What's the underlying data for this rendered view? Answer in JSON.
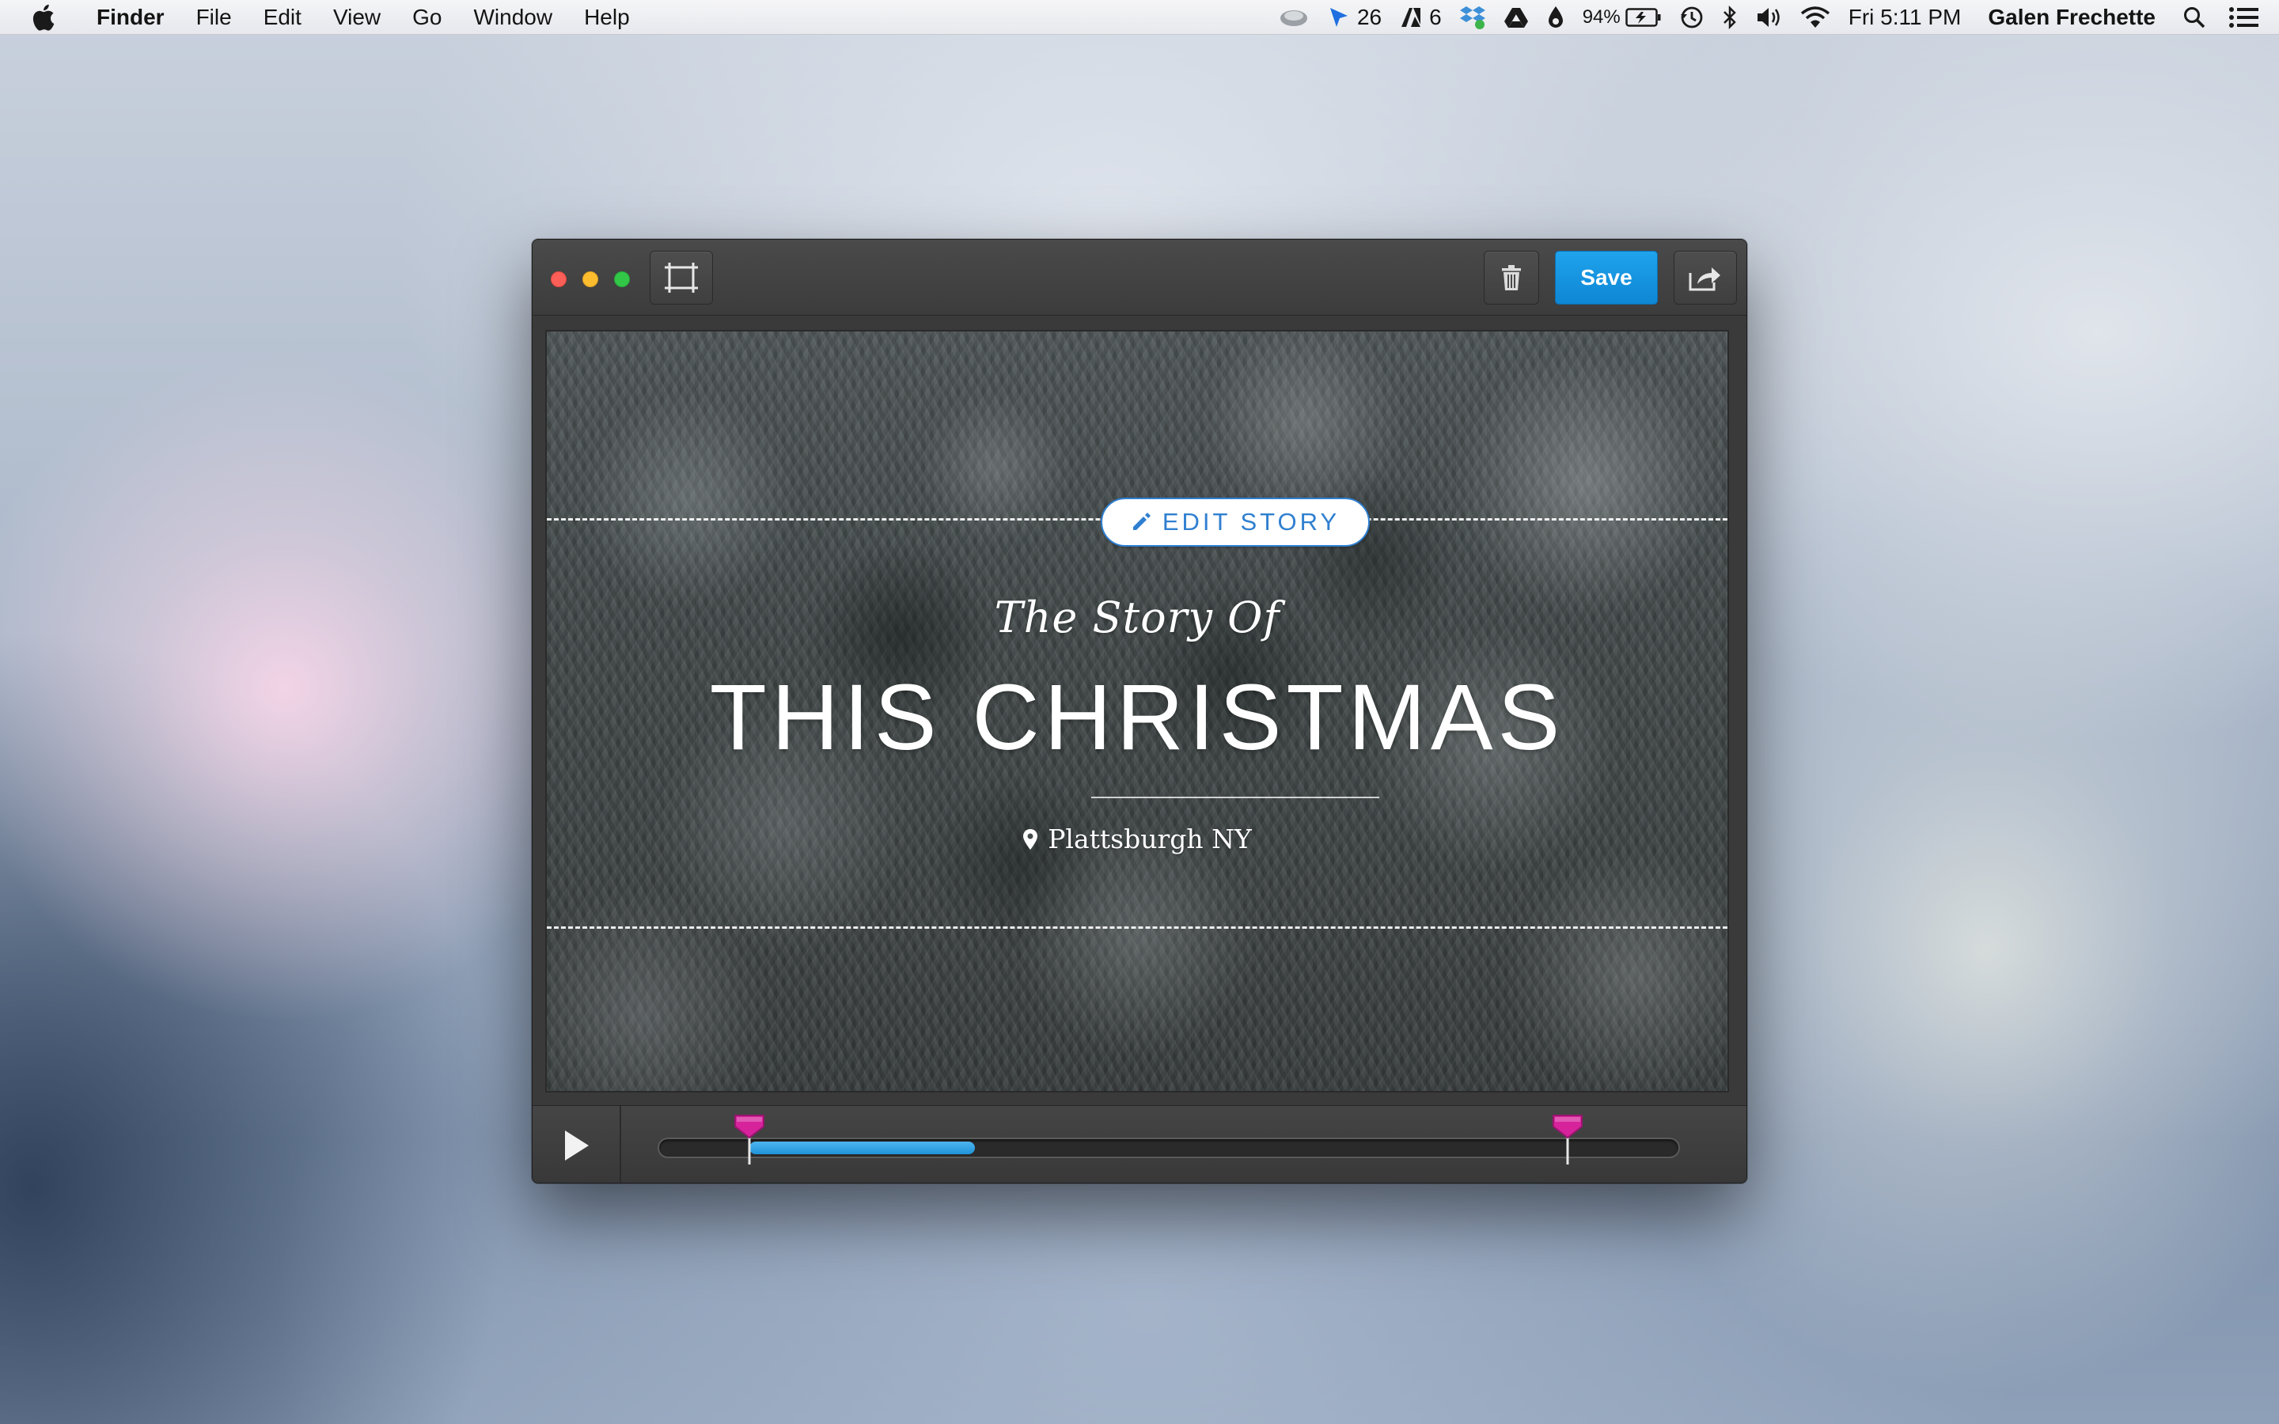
{
  "menubar": {
    "app_name": "Finder",
    "menus": [
      "File",
      "Edit",
      "View",
      "Go",
      "Window",
      "Help"
    ],
    "status": {
      "cursor_count": "26",
      "adobe_count": "6",
      "battery": "94%",
      "clock": "Fri 5:11 PM",
      "user": "Galen Frechette"
    }
  },
  "window": {
    "toolbar": {
      "save_label": "Save"
    },
    "story": {
      "edit_label": "EDIT STORY",
      "subtitle": "The Story Of",
      "title": "THIS CHRISTMAS",
      "location": "Plattsburgh NY"
    },
    "playback": {
      "start_marker_fraction": 0.09,
      "end_marker_fraction": 0.89,
      "progress_fraction": 0.31
    }
  },
  "colors": {
    "accent": "#1a9be6",
    "edit_story_text": "#2f7fd0",
    "marker": "#d6239b",
    "progress": "#3aa8e8"
  }
}
